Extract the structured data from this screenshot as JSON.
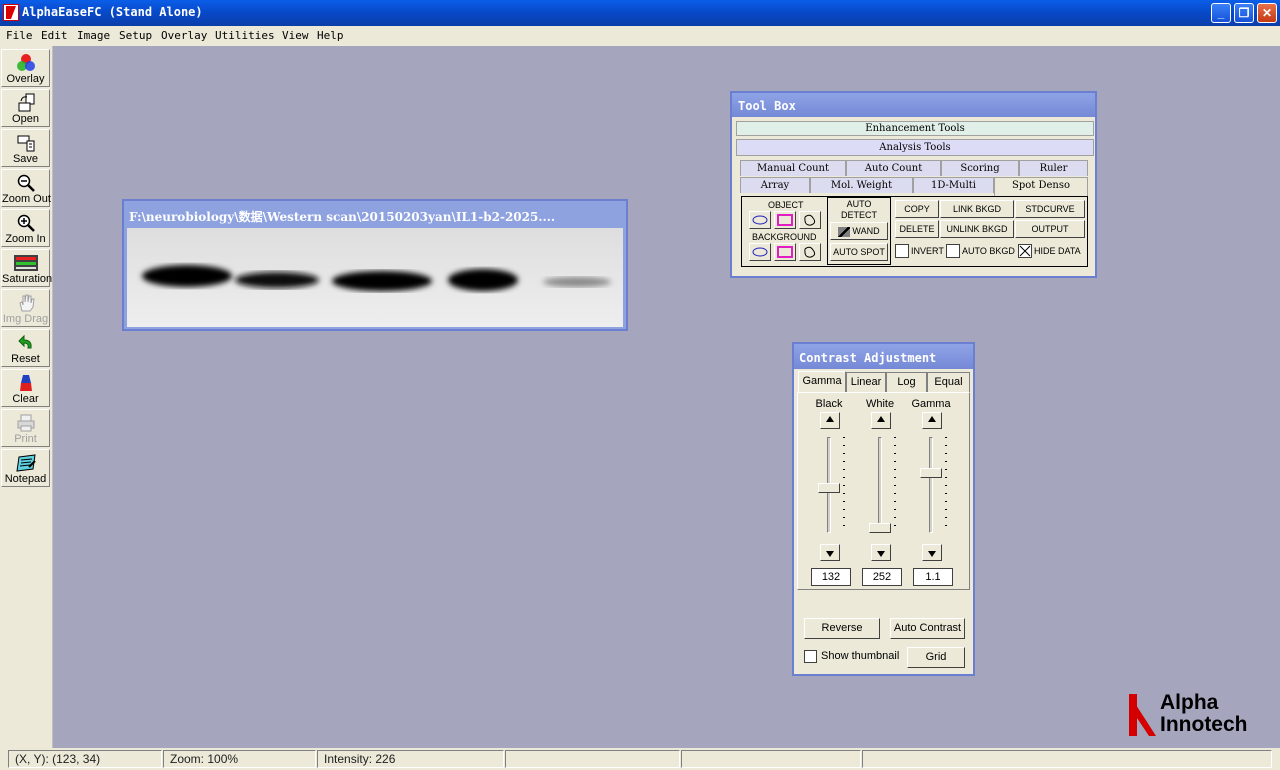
{
  "window": {
    "title": "AlphaEaseFC (Stand Alone)"
  },
  "menu": [
    "File",
    "Edit",
    "Image",
    "Setup",
    "Overlay",
    "Utilities",
    "View",
    "Help"
  ],
  "toolbar": {
    "overlay": "Overlay",
    "open": "Open",
    "save": "Save",
    "zoom_out": "Zoom Out",
    "zoom_in": "Zoom In",
    "saturation": "Saturation",
    "img_drag": "Img Drag",
    "reset": "Reset",
    "clear": "Clear",
    "print": "Print",
    "notepad": "Notepad"
  },
  "image_window": {
    "title": "F:\\neurobiology\\数据\\Western scan\\20150203yan\\IL1-b2-2025...."
  },
  "toolbox": {
    "title": "Tool Box",
    "enhancement": "Enhancement Tools",
    "analysis": "Analysis Tools",
    "tabs_row1": [
      "Manual Count",
      "Auto Count",
      "Scoring",
      "Ruler"
    ],
    "tabs_row2": [
      "Array",
      "Mol. Weight",
      "1D-Multi",
      "Spot Denso"
    ],
    "object": "OBJECT",
    "background": "BACKGROUND",
    "auto_detect": "AUTO DETECT",
    "wand": "WAND",
    "auto_spot": "AUTO SPOT",
    "copy": "COPY",
    "link_bkgd": "LINK BKGD",
    "stdcurve": "STDCURVE",
    "delete": "DELETE",
    "unlink_bkgd": "UNLINK BKGD",
    "output": "OUTPUT",
    "invert": "INVERT",
    "auto_bkgd": "AUTO BKGD",
    "hide_data": "HIDE DATA"
  },
  "contrast": {
    "title": "Contrast Adjustment",
    "tabs": [
      "Gamma",
      "Linear",
      "Log",
      "Equal"
    ],
    "black_label": "Black",
    "white_label": "White",
    "gamma_label": "Gamma",
    "black_value": "132",
    "white_value": "252",
    "gamma_value": "1.1",
    "reverse": "Reverse",
    "auto_contrast": "Auto Contrast",
    "show_thumbnail": "Show thumbnail",
    "grid": "Grid"
  },
  "logo": {
    "line1": "Alpha",
    "line2": "Innotech",
    "color": "#d40000"
  },
  "status": {
    "xy": "(X, Y): (123, 34)",
    "zoom": "Zoom: 100%",
    "intensity": "Intensity: 226"
  }
}
